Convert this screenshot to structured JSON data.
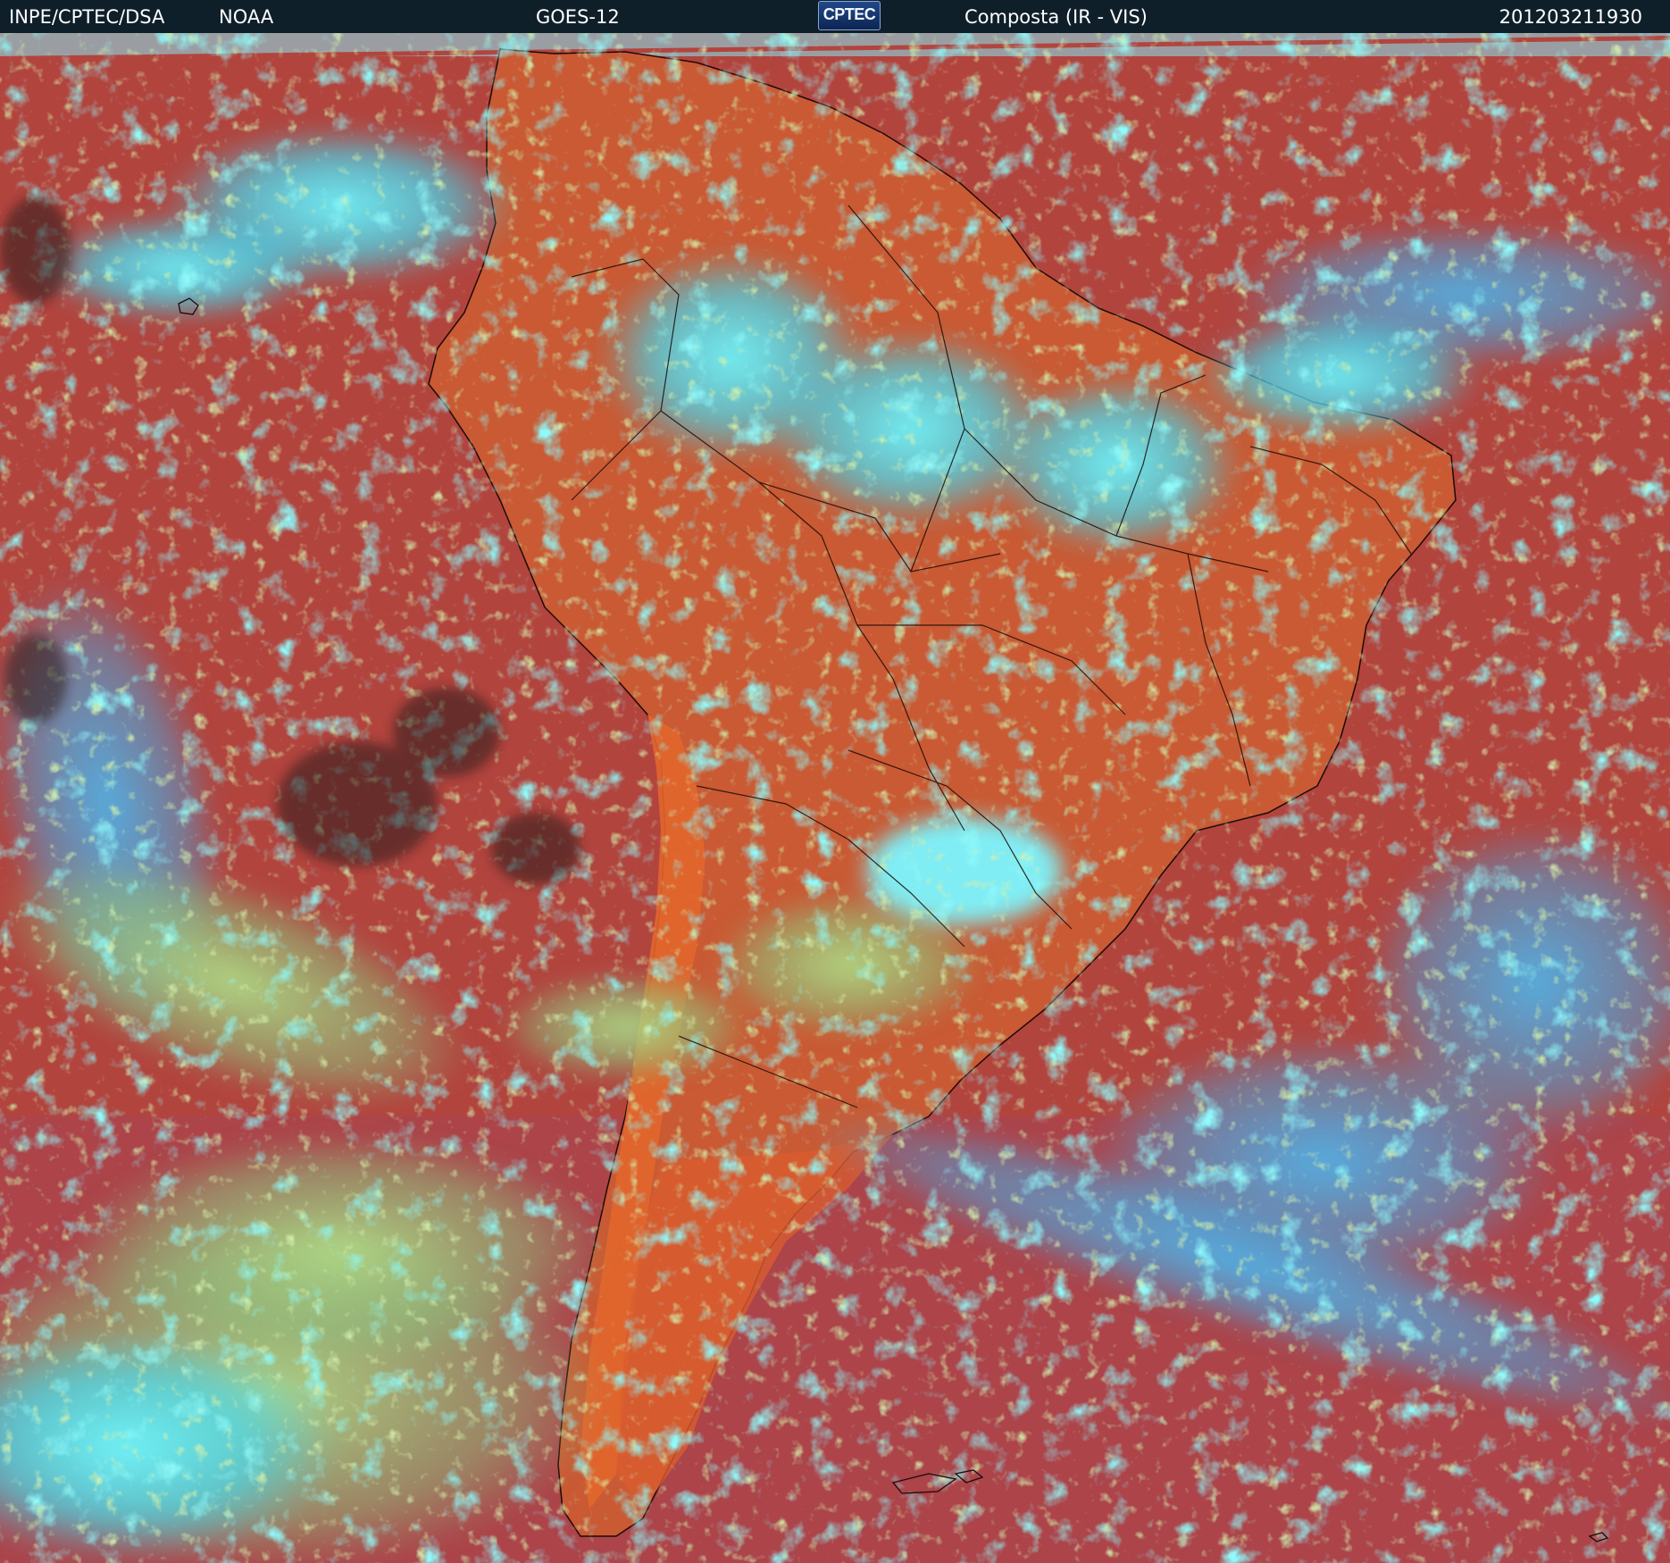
{
  "header": {
    "organization": "INPE/CPTEC/DSA",
    "agency": "NOAA",
    "satellite": "GOES-12",
    "logo_text": "CPTEC",
    "product": "Composta (IR - VIS)",
    "timestamp": "201203211930"
  },
  "colors": {
    "header_background": "#0f1f2a",
    "header_text": "#ffffff",
    "land_warm": "#c8502c",
    "ocean_warm": "#b04040",
    "cloud_high": "#50f0f8",
    "cloud_mid": "#a0e070",
    "coastline": "#000000"
  }
}
